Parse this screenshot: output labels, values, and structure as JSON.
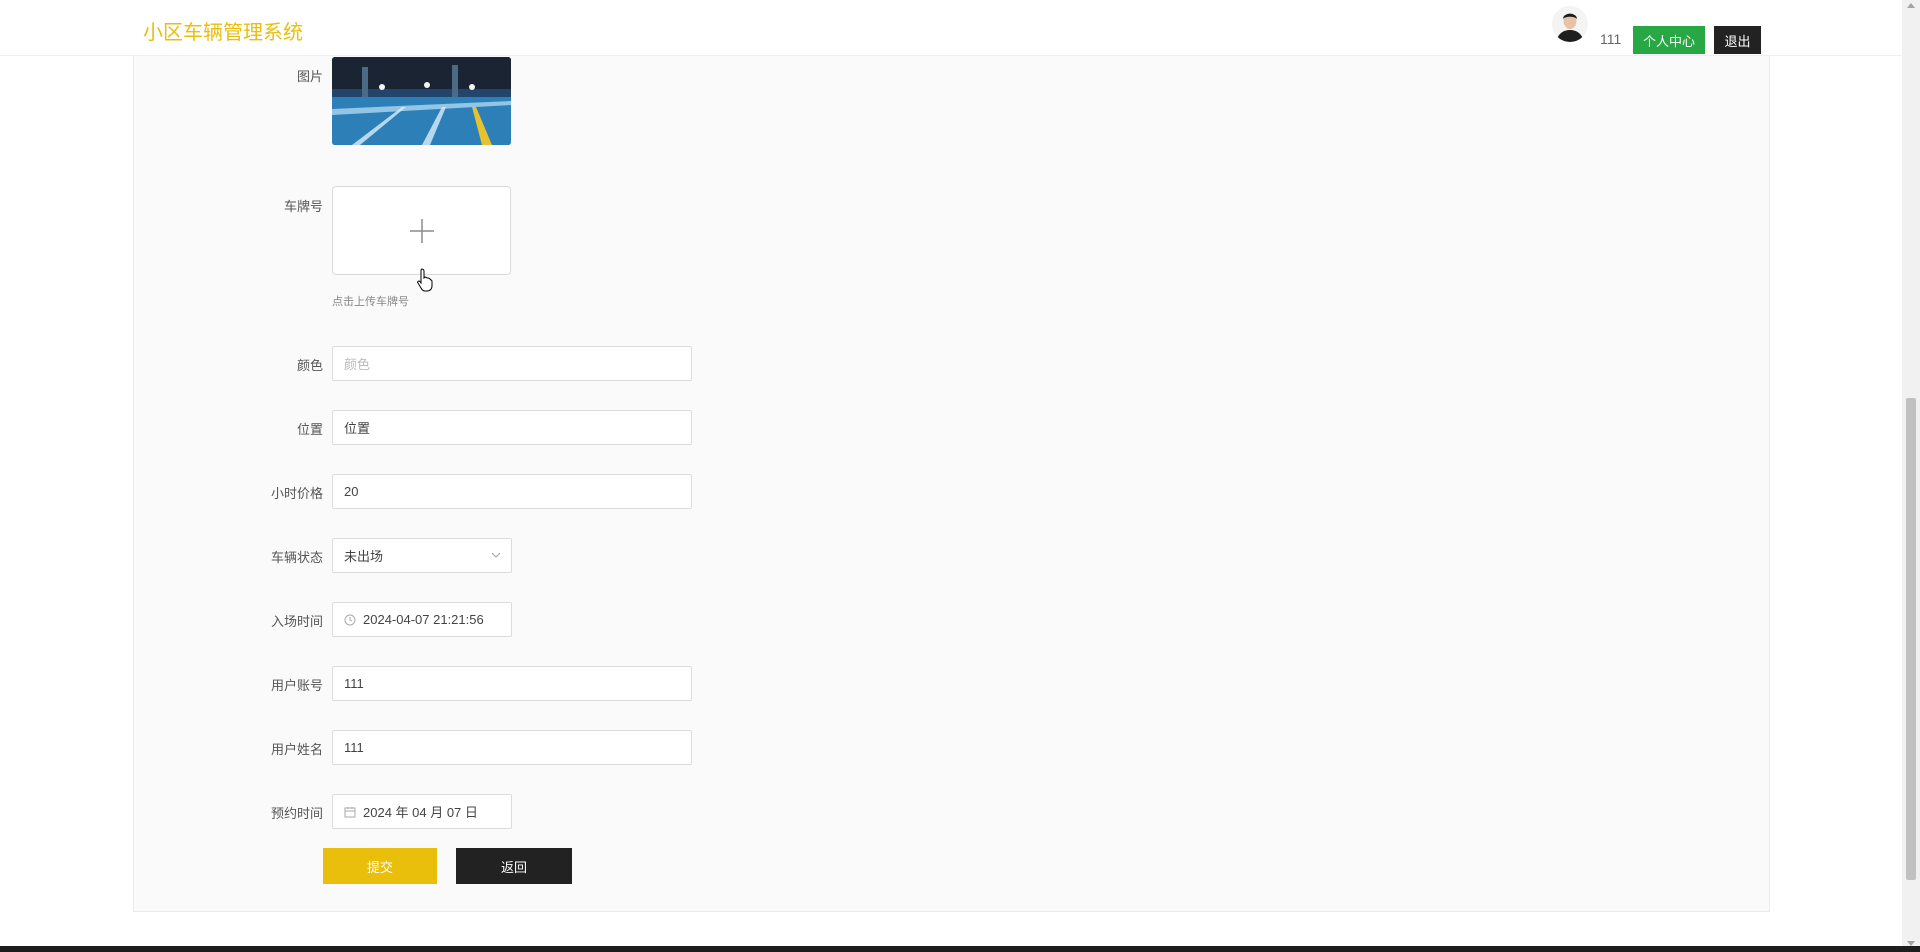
{
  "header": {
    "logo": "小区车辆管理系统",
    "username": "111",
    "profile_button": "个人中心",
    "logout_button": "退出"
  },
  "form": {
    "image_label": "图片",
    "plate_label": "车牌号",
    "plate_upload_tip": "点击上传车牌号",
    "color_label": "颜色",
    "color_placeholder": "颜色",
    "position_label": "位置",
    "position_value": "位置",
    "price_label": "小时价格",
    "price_value": "20",
    "status_label": "车辆状态",
    "status_value": "未出场",
    "entry_label": "入场时间",
    "entry_value": "2024-04-07 21:21:56",
    "account_label": "用户账号",
    "account_value": "111",
    "name_label": "用户姓名",
    "name_value": "111",
    "booking_label": "预约时间",
    "booking_value": "2024 年 04 月 07 日",
    "submit_button": "提交",
    "back_button": "返回"
  },
  "colors": {
    "brand_yellow": "#e9bf0b",
    "profile_green": "#28a745",
    "dark": "#222222"
  }
}
